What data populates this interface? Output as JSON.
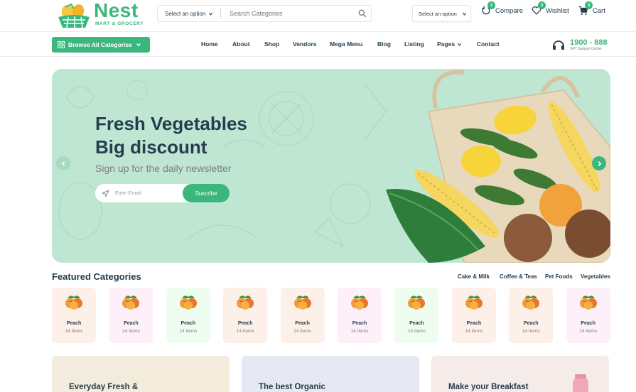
{
  "brand": {
    "name": "Nest",
    "tagline": "MART & GROCERY"
  },
  "header": {
    "category_select": "Select an option",
    "search_placeholder": "Search Categories",
    "location_select": "Select an option",
    "compare": {
      "label": "Compare",
      "count": "3"
    },
    "wishlist": {
      "label": "Wishlist",
      "count": "3"
    },
    "cart": {
      "label": "Cart",
      "count": "3"
    }
  },
  "nav": {
    "browse_label": "Browse All Categories",
    "links": [
      "Home",
      "About",
      "Shop",
      "Vendors",
      "Mega Menu",
      "Blog",
      "Listing",
      "Pages",
      "Contact"
    ],
    "hotline_number": "1900 - 888",
    "hotline_label": "24/7 Support Center"
  },
  "hero": {
    "title_line1": "Fresh Vegetables",
    "title_line2": "Big discount",
    "subtitle": "Sign up for the daily newsletter",
    "email_placeholder": "Enter Email",
    "subscribe_label": "Suscribe"
  },
  "featured": {
    "title": "Featured Categories",
    "filters": [
      "Cake & Milk",
      "Coffee & Teas",
      "Pet Foods",
      "Vegetables"
    ],
    "categories": [
      {
        "name": "Peach",
        "count": "14 Items",
        "bg": "#fdf0e8"
      },
      {
        "name": "Peach",
        "count": "14 Items",
        "bg": "#fdf0f9"
      },
      {
        "name": "Peach",
        "count": "14 Items",
        "bg": "#eefdef"
      },
      {
        "name": "Peach",
        "count": "14 Items",
        "bg": "#fdf0e8"
      },
      {
        "name": "Peach",
        "count": "14 Items",
        "bg": "#fdf0e8"
      },
      {
        "name": "Peach",
        "count": "14 Items",
        "bg": "#fdf0f9"
      },
      {
        "name": "Peach",
        "count": "14 Items",
        "bg": "#eefdef"
      },
      {
        "name": "Peach",
        "count": "14 Items",
        "bg": "#fdf0e8"
      },
      {
        "name": "Peach",
        "count": "14 Items",
        "bg": "#fdf0e8"
      },
      {
        "name": "Peach",
        "count": "14 Items",
        "bg": "#fdf0f9"
      }
    ]
  },
  "promos": [
    {
      "title": "Everyday Fresh &",
      "bg": "#f3ebdb"
    },
    {
      "title": "The best Organic",
      "bg": "#e6e9f3"
    },
    {
      "title": "Make your Breakfast",
      "bg": "#f5ecea"
    }
  ],
  "colors": {
    "accent": "#3bb77e",
    "heading": "#253d4e",
    "hero_bg": "#bfe6d2"
  }
}
